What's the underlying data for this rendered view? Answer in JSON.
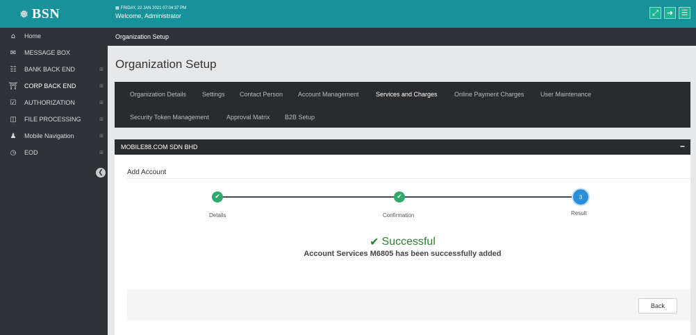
{
  "app": {
    "logo_text": "BSN",
    "date_line": "FRIDAY, 22 JAN 2021 07:04:37 PM",
    "welcome": "Welcome, Administrator",
    "top_icons": [
      "expand-icon",
      "logout-icon",
      "menu-icon"
    ]
  },
  "sidebar": {
    "items": [
      {
        "label": "Home",
        "icon": "home-icon",
        "expandable": false
      },
      {
        "label": "MESSAGE BOX",
        "icon": "envelope-icon",
        "expandable": false
      },
      {
        "label": "BANK BACK END",
        "icon": "sitemap-icon",
        "expandable": true
      },
      {
        "label": "CORP BACK END",
        "icon": "bank-icon",
        "expandable": true
      },
      {
        "label": "AUTHORIZATION",
        "icon": "checkbox-icon",
        "expandable": true
      },
      {
        "label": "FILE PROCESSING",
        "icon": "folder-open-icon",
        "expandable": true
      },
      {
        "label": "Mobile Navigation",
        "icon": "users-icon",
        "expandable": true
      },
      {
        "label": "EOD",
        "icon": "clock-icon",
        "expandable": true
      }
    ]
  },
  "breadcrumb": "Organization Setup",
  "page_title": "Organization Setup",
  "tabs": {
    "row1": [
      "Organization Details",
      "Settings",
      "Contact Person",
      "Account Management",
      "Services and Charges",
      "Online Payment Charges",
      "User Maintenance"
    ],
    "row2": [
      "Security Token Management",
      "Approval Matrix",
      "B2B Setup"
    ],
    "active": "Services and Charges"
  },
  "panel": {
    "title": "MOBILE88.COM SDN BHD",
    "collapse_symbol": "−",
    "section_title": "Add Account",
    "steps": [
      {
        "label": "Details",
        "status": "done"
      },
      {
        "label": "Confirmation",
        "status": "done"
      },
      {
        "label": "Result",
        "status": "current",
        "number": "3"
      }
    ],
    "success_title": "Successful",
    "success_message": "Account Services M6805 has been successfully added",
    "back_label": "Back"
  },
  "colors": {
    "topbar": "#17919a",
    "sidebar": "#2f3237",
    "tabbar": "#2a2b2d",
    "step_done": "#2ea96b",
    "step_current": "#2a8ed8",
    "success": "#2e7d32"
  }
}
